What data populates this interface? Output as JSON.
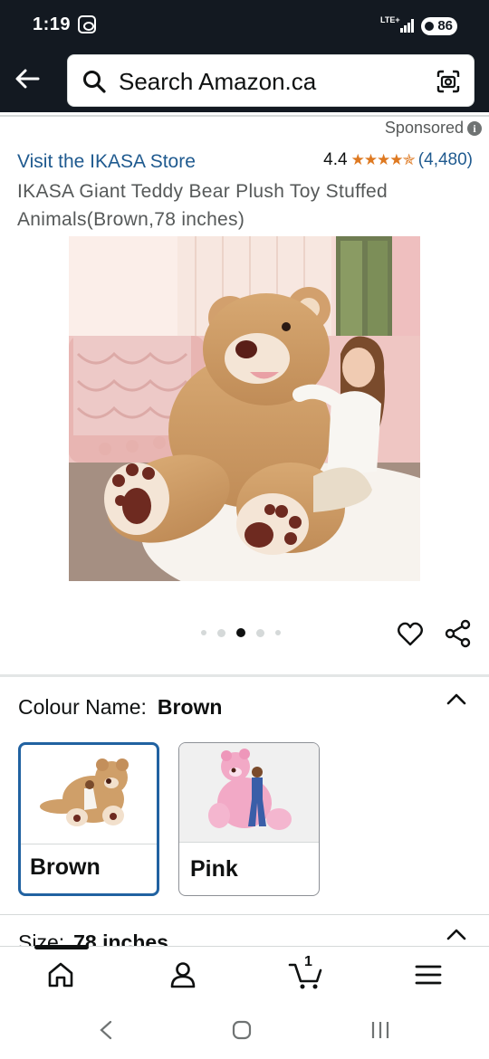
{
  "status_bar": {
    "time": "1:19",
    "network": "LTE+",
    "battery": "86"
  },
  "search": {
    "placeholder": "Search Amazon.ca"
  },
  "sponsored_label": "Sponsored",
  "store_link": "Visit the IKASA Store",
  "rating": {
    "value": "4.4",
    "stars": "★★★★✯",
    "count": "(4,480)"
  },
  "product": {
    "title": "IKASA Giant Teddy Bear Plush Toy Stuffed Animals(Brown,78 inches)"
  },
  "carousel": {
    "total": 5,
    "active_index": 2
  },
  "variation": {
    "label": "Colour Name:",
    "selected": "Brown",
    "options": [
      {
        "label": "Brown",
        "selected": true
      },
      {
        "label": "Pink",
        "selected": false
      }
    ]
  },
  "size": {
    "label": "Size:",
    "selected": "78 inches"
  },
  "cart": {
    "count": "1"
  },
  "colors": {
    "header_bg": "#131921",
    "link": "#1f5a8f",
    "star": "#de7921",
    "selected_border": "#2162a1"
  }
}
